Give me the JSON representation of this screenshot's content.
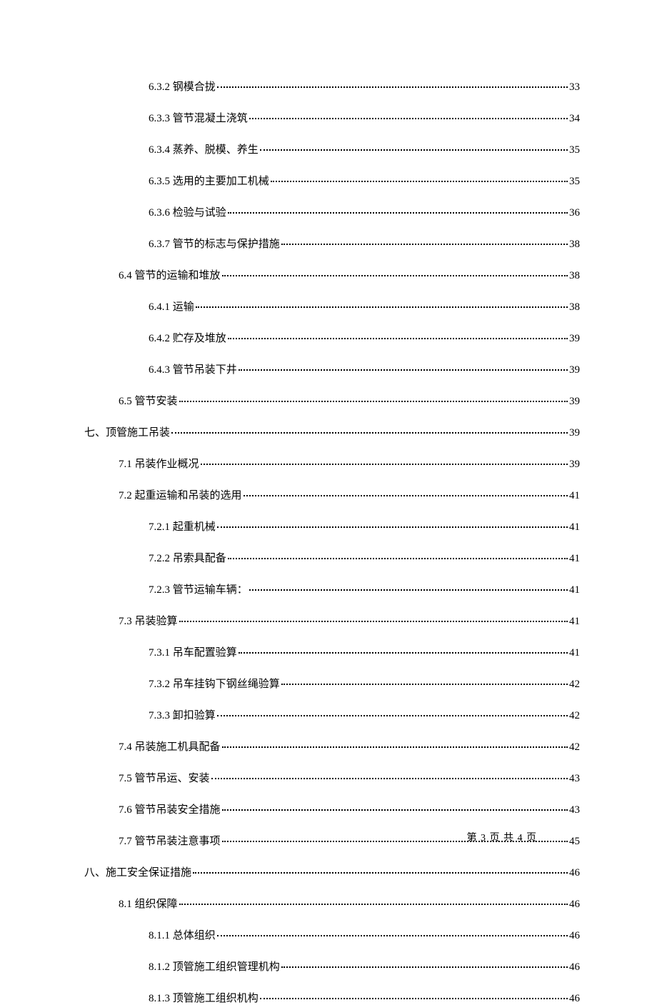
{
  "toc": [
    {
      "level": 3,
      "label": "6.3.2 钢模合拢",
      "page": "33"
    },
    {
      "level": 3,
      "label": "6.3.3 管节混凝土浇筑",
      "page": "34"
    },
    {
      "level": 3,
      "label": "6.3.4 蒸养、脱模、养生",
      "page": "35"
    },
    {
      "level": 3,
      "label": "6.3.5 选用的主要加工机械",
      "page": "35"
    },
    {
      "level": 3,
      "label": "6.3.6 检验与试验",
      "page": "36"
    },
    {
      "level": 3,
      "label": "6.3.7 管节的标志与保护措施",
      "page": "38"
    },
    {
      "level": 2,
      "label": "6.4 管节的运输和堆放",
      "page": "38"
    },
    {
      "level": 3,
      "label": "6.4.1 运输",
      "page": "38"
    },
    {
      "level": 3,
      "label": "6.4.2 贮存及堆放",
      "page": "39"
    },
    {
      "level": 3,
      "label": "6.4.3 管节吊装下井",
      "page": "39"
    },
    {
      "level": 2,
      "label": "6.5 管节安装",
      "page": "39"
    },
    {
      "level": 1,
      "label": "七、顶管施工吊装",
      "page": "39"
    },
    {
      "level": 2,
      "label": "7.1 吊装作业概况",
      "page": "39"
    },
    {
      "level": 2,
      "label": "7.2 起重运输和吊装的选用",
      "page": "41"
    },
    {
      "level": 3,
      "label": "7.2.1 起重机械",
      "page": "41"
    },
    {
      "level": 3,
      "label": "7.2.2 吊索具配备",
      "page": "41"
    },
    {
      "level": 3,
      "label": "7.2.3 管节运输车辆：",
      "page": "41"
    },
    {
      "level": 2,
      "label": "7.3 吊装验算",
      "page": "41"
    },
    {
      "level": 3,
      "label": "7.3.1 吊车配置验算",
      "page": "41"
    },
    {
      "level": 3,
      "label": "7.3.2 吊车挂钩下钢丝绳验算",
      "page": "42"
    },
    {
      "level": 3,
      "label": "7.3.3 卸扣验算",
      "page": "42"
    },
    {
      "level": 2,
      "label": "7.4 吊装施工机具配备",
      "page": "42"
    },
    {
      "level": 2,
      "label": "7.5 管节吊运、安装",
      "page": "43"
    },
    {
      "level": 2,
      "label": "7.6 管节吊装安全措施",
      "page": "43"
    },
    {
      "level": 2,
      "label": "7.7 管节吊装注意事项",
      "page": "45"
    },
    {
      "level": 1,
      "label": "八、施工安全保证措施",
      "page": "46"
    },
    {
      "level": 2,
      "label": "8.1 组织保障",
      "page": "46"
    },
    {
      "level": 3,
      "label": "8.1.1 总体组织",
      "page": "46"
    },
    {
      "level": 3,
      "label": "8.1.2 顶管施工组织管理机构",
      "page": "46"
    },
    {
      "level": 3,
      "label": "8.1.3 顶管施工组织机构",
      "page": "46"
    }
  ],
  "footer": "第 3 页 共 4 页"
}
